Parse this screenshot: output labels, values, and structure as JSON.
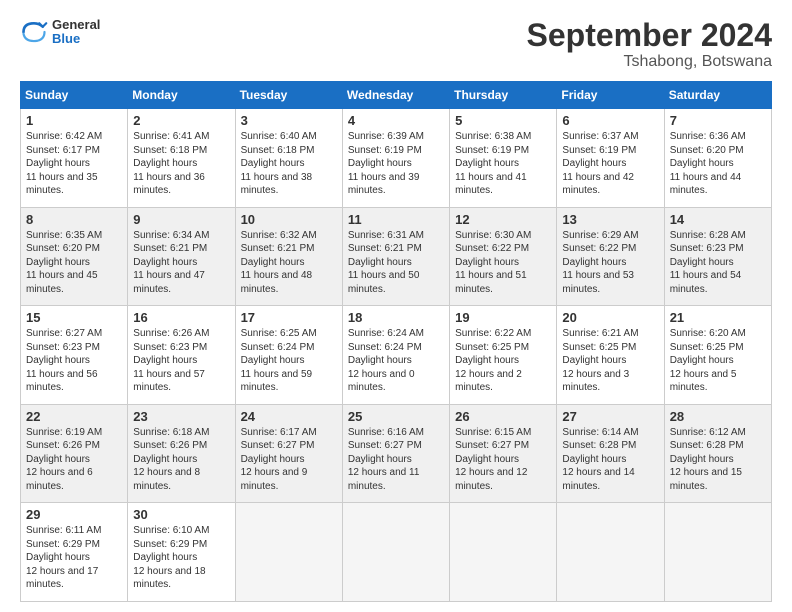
{
  "header": {
    "logo_line1": "General",
    "logo_line2": "Blue",
    "title": "September 2024",
    "subtitle": "Tshabong, Botswana"
  },
  "columns": [
    "Sunday",
    "Monday",
    "Tuesday",
    "Wednesday",
    "Thursday",
    "Friday",
    "Saturday"
  ],
  "weeks": [
    [
      {
        "day": "1",
        "sunrise": "6:42 AM",
        "sunset": "6:17 PM",
        "daylight": "11 hours and 35 minutes."
      },
      {
        "day": "2",
        "sunrise": "6:41 AM",
        "sunset": "6:18 PM",
        "daylight": "11 hours and 36 minutes."
      },
      {
        "day": "3",
        "sunrise": "6:40 AM",
        "sunset": "6:18 PM",
        "daylight": "11 hours and 38 minutes."
      },
      {
        "day": "4",
        "sunrise": "6:39 AM",
        "sunset": "6:19 PM",
        "daylight": "11 hours and 39 minutes."
      },
      {
        "day": "5",
        "sunrise": "6:38 AM",
        "sunset": "6:19 PM",
        "daylight": "11 hours and 41 minutes."
      },
      {
        "day": "6",
        "sunrise": "6:37 AM",
        "sunset": "6:19 PM",
        "daylight": "11 hours and 42 minutes."
      },
      {
        "day": "7",
        "sunrise": "6:36 AM",
        "sunset": "6:20 PM",
        "daylight": "11 hours and 44 minutes."
      }
    ],
    [
      {
        "day": "8",
        "sunrise": "6:35 AM",
        "sunset": "6:20 PM",
        "daylight": "11 hours and 45 minutes."
      },
      {
        "day": "9",
        "sunrise": "6:34 AM",
        "sunset": "6:21 PM",
        "daylight": "11 hours and 47 minutes."
      },
      {
        "day": "10",
        "sunrise": "6:32 AM",
        "sunset": "6:21 PM",
        "daylight": "11 hours and 48 minutes."
      },
      {
        "day": "11",
        "sunrise": "6:31 AM",
        "sunset": "6:21 PM",
        "daylight": "11 hours and 50 minutes."
      },
      {
        "day": "12",
        "sunrise": "6:30 AM",
        "sunset": "6:22 PM",
        "daylight": "11 hours and 51 minutes."
      },
      {
        "day": "13",
        "sunrise": "6:29 AM",
        "sunset": "6:22 PM",
        "daylight": "11 hours and 53 minutes."
      },
      {
        "day": "14",
        "sunrise": "6:28 AM",
        "sunset": "6:23 PM",
        "daylight": "11 hours and 54 minutes."
      }
    ],
    [
      {
        "day": "15",
        "sunrise": "6:27 AM",
        "sunset": "6:23 PM",
        "daylight": "11 hours and 56 minutes."
      },
      {
        "day": "16",
        "sunrise": "6:26 AM",
        "sunset": "6:23 PM",
        "daylight": "11 hours and 57 minutes."
      },
      {
        "day": "17",
        "sunrise": "6:25 AM",
        "sunset": "6:24 PM",
        "daylight": "11 hours and 59 minutes."
      },
      {
        "day": "18",
        "sunrise": "6:24 AM",
        "sunset": "6:24 PM",
        "daylight": "12 hours and 0 minutes."
      },
      {
        "day": "19",
        "sunrise": "6:22 AM",
        "sunset": "6:25 PM",
        "daylight": "12 hours and 2 minutes."
      },
      {
        "day": "20",
        "sunrise": "6:21 AM",
        "sunset": "6:25 PM",
        "daylight": "12 hours and 3 minutes."
      },
      {
        "day": "21",
        "sunrise": "6:20 AM",
        "sunset": "6:25 PM",
        "daylight": "12 hours and 5 minutes."
      }
    ],
    [
      {
        "day": "22",
        "sunrise": "6:19 AM",
        "sunset": "6:26 PM",
        "daylight": "12 hours and 6 minutes."
      },
      {
        "day": "23",
        "sunrise": "6:18 AM",
        "sunset": "6:26 PM",
        "daylight": "12 hours and 8 minutes."
      },
      {
        "day": "24",
        "sunrise": "6:17 AM",
        "sunset": "6:27 PM",
        "daylight": "12 hours and 9 minutes."
      },
      {
        "day": "25",
        "sunrise": "6:16 AM",
        "sunset": "6:27 PM",
        "daylight": "12 hours and 11 minutes."
      },
      {
        "day": "26",
        "sunrise": "6:15 AM",
        "sunset": "6:27 PM",
        "daylight": "12 hours and 12 minutes."
      },
      {
        "day": "27",
        "sunrise": "6:14 AM",
        "sunset": "6:28 PM",
        "daylight": "12 hours and 14 minutes."
      },
      {
        "day": "28",
        "sunrise": "6:12 AM",
        "sunset": "6:28 PM",
        "daylight": "12 hours and 15 minutes."
      }
    ],
    [
      {
        "day": "29",
        "sunrise": "6:11 AM",
        "sunset": "6:29 PM",
        "daylight": "12 hours and 17 minutes."
      },
      {
        "day": "30",
        "sunrise": "6:10 AM",
        "sunset": "6:29 PM",
        "daylight": "12 hours and 18 minutes."
      },
      null,
      null,
      null,
      null,
      null
    ]
  ]
}
